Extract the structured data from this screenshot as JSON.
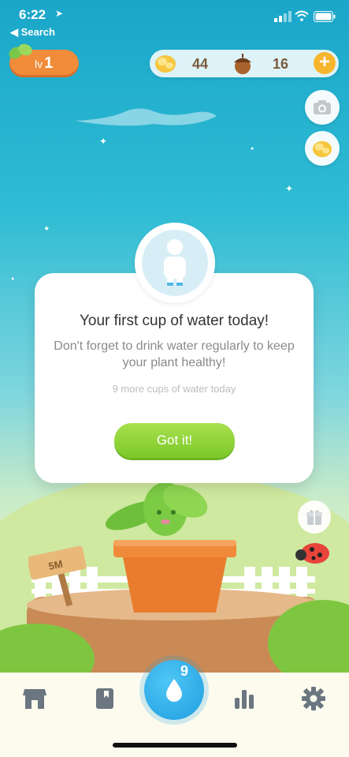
{
  "status_bar": {
    "time": "6:22",
    "back_label": "◀ Search"
  },
  "level": {
    "prefix": "lv",
    "value": "1"
  },
  "currency": {
    "coins": "44",
    "acorns": "16",
    "add_label": "+"
  },
  "modal": {
    "title": "Your first cup of water today!",
    "body": "Don't forget to drink water regularly to keep your plant healthy!",
    "note": "9 more cups of water today",
    "button_label": "Got it!"
  },
  "scene": {
    "sign_label": "5M"
  },
  "tabbar": {
    "water_count": "9"
  },
  "colors": {
    "sky_top": "#1aa6c9",
    "accent_green": "#8ed43a",
    "water_blue": "#1f9ee0",
    "level_orange": "#f08c3a"
  },
  "icons": [
    "location-arrow-icon",
    "signal-icon",
    "wifi-icon",
    "battery-icon",
    "leaf-icon",
    "coin-icon",
    "acorn-icon",
    "plus-icon",
    "camera-icon",
    "nugget-icon",
    "person-icon",
    "gift-icon",
    "shop-icon",
    "bookmark-icon",
    "water-drop-icon",
    "stats-icon",
    "gear-icon"
  ]
}
